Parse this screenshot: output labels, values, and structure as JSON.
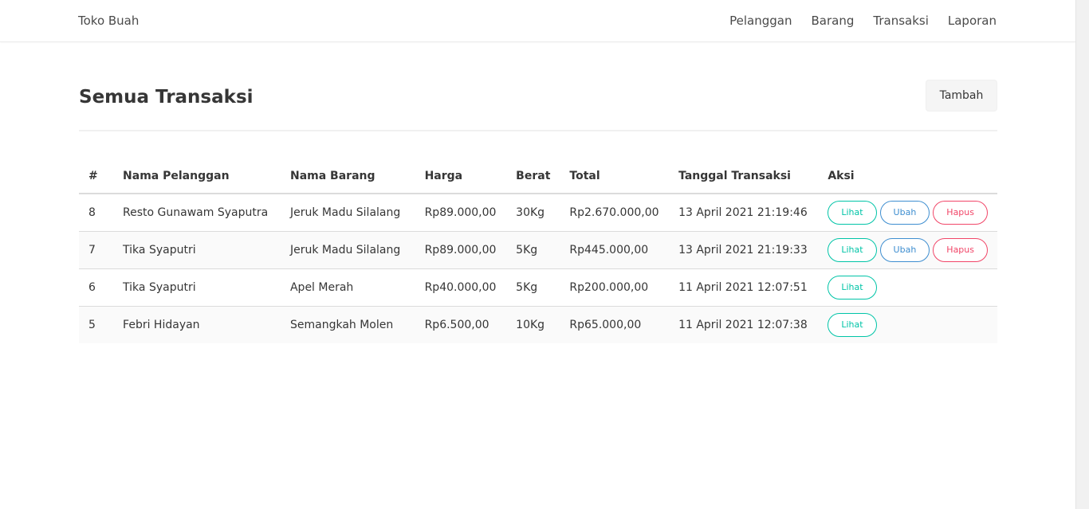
{
  "navbar": {
    "brand": "Toko Buah",
    "links": [
      "Pelanggan",
      "Barang",
      "Transaksi",
      "Laporan"
    ]
  },
  "page": {
    "title": "Semua Transaksi",
    "add_label": "Tambah"
  },
  "table": {
    "headers": [
      "#",
      "Nama Pelanggan",
      "Nama Barang",
      "Harga",
      "Berat",
      "Total",
      "Tanggal Transaksi",
      "Aksi"
    ],
    "rows": [
      {
        "id": "8",
        "pelanggan": "Resto Gunawam Syaputra",
        "barang": "Jeruk Madu Silalang",
        "harga": "Rp89.000,00",
        "berat": "30Kg",
        "total": "Rp2.670.000,00",
        "tanggal": "13 April 2021 21:19:46",
        "actions": [
          "Lihat",
          "Ubah",
          "Hapus"
        ]
      },
      {
        "id": "7",
        "pelanggan": "Tika Syaputri",
        "barang": "Jeruk Madu Silalang",
        "harga": "Rp89.000,00",
        "berat": "5Kg",
        "total": "Rp445.000,00",
        "tanggal": "13 April 2021 21:19:33",
        "actions": [
          "Lihat",
          "Ubah",
          "Hapus"
        ]
      },
      {
        "id": "6",
        "pelanggan": "Tika Syaputri",
        "barang": "Apel Merah",
        "harga": "Rp40.000,00",
        "berat": "5Kg",
        "total": "Rp200.000,00",
        "tanggal": "11 April 2021 12:07:51",
        "actions": [
          "Lihat"
        ]
      },
      {
        "id": "5",
        "pelanggan": "Febri Hidayan",
        "barang": "Semangkah Molen",
        "harga": "Rp6.500,00",
        "berat": "10Kg",
        "total": "Rp65.000,00",
        "tanggal": "11 April 2021 12:07:38",
        "actions": [
          "Lihat"
        ]
      }
    ]
  },
  "colors": {
    "lihat": "#00c4a7",
    "ubah": "#3e8ed0",
    "hapus": "#f14668"
  }
}
